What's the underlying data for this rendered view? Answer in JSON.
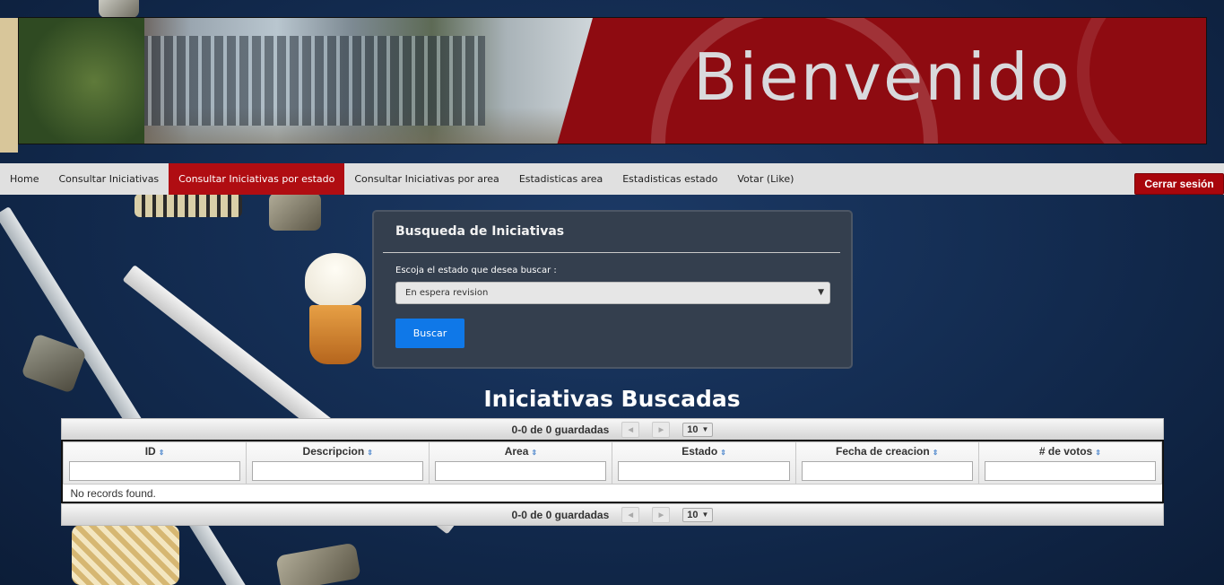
{
  "banner": {
    "title": "Bienvenido"
  },
  "nav": {
    "items": [
      {
        "label": "Home"
      },
      {
        "label": "Consultar Iniciativas"
      },
      {
        "label": "Consultar Iniciativas por estado",
        "active": true
      },
      {
        "label": "Consultar Iniciativas por area"
      },
      {
        "label": "Estadisticas area"
      },
      {
        "label": "Estadisticas estado"
      },
      {
        "label": "Votar (Like)"
      }
    ],
    "logout_label": "Cerrar sesión"
  },
  "search": {
    "title": "Busqueda de Iniciativas",
    "label": "Escoja el estado que desea buscar :",
    "selected": "En espera revision",
    "button": "Buscar"
  },
  "results": {
    "title": "Iniciativas Buscadas",
    "paginator_text": "0-0 de 0 guardadas",
    "rows_per_page": "10",
    "columns": [
      "ID",
      "Descripcion",
      "Area",
      "Estado",
      "Fecha de creacion",
      "# de votos"
    ],
    "empty_message": "No records found."
  },
  "colors": {
    "accent_red": "#b00d12",
    "button_blue": "#0f78e8",
    "card_bg": "#343f4e"
  }
}
